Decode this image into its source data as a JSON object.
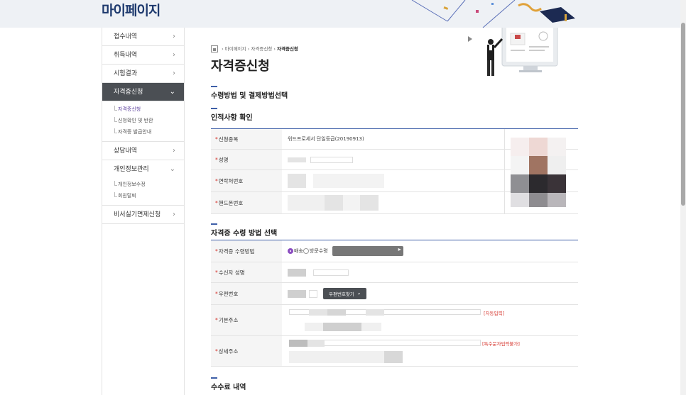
{
  "header": {
    "title": "마이페이지"
  },
  "sidebar": {
    "items": [
      {
        "label": "접수내역"
      },
      {
        "label": "취득내역"
      },
      {
        "label": "시험결과"
      },
      {
        "label": "자격증신청"
      },
      {
        "label": "상담내역"
      },
      {
        "label": "개인정보관리"
      },
      {
        "label": "비서실기면제신청"
      }
    ],
    "sub1": [
      "자격증신청",
      "신청확인 및 반환",
      "자격증 발급안내"
    ],
    "sub2": [
      "개인정보수정",
      "회원탈퇴"
    ]
  },
  "breadcrumb": {
    "sep": " › ",
    "c1": "마이페이지",
    "c2": "자격증신청",
    "c3": "자격증신청"
  },
  "page_title": "자격증신청",
  "sections": {
    "method": "수령방법 및 결제방법선택",
    "identity": "인적사항 확인",
    "receive": "자격증 수령 방법 선택",
    "fee": "수수료 내역"
  },
  "identity": {
    "required_mark": "*",
    "apply_item_label": "신청종목",
    "apply_item_value": "워드프로세서 단일등급(20190913)",
    "name_label": "성명",
    "phone_label": "연락처번호",
    "mobile_label": "핸드폰번호"
  },
  "receive": {
    "method_label": "자격증 수령방법",
    "opt_delivery": "배송",
    "opt_visit": "방문수령",
    "recipient_label": "수신자 성명",
    "zip_label": "우편번호",
    "zip_button": "우편번호찾기",
    "address_label": "기본주소",
    "address_note": "[자동입력]",
    "detail_label": "상세주소",
    "detail_note": "[특수문자입력불가]"
  },
  "colors": {
    "accent": "#3e5fa8",
    "active_menu": "#4b4f54",
    "required": "#d6342c",
    "radio": "#8a4cc0"
  },
  "icons": {
    "home": "home-icon",
    "chevron": "chevron-right-icon",
    "search": "search-icon"
  }
}
